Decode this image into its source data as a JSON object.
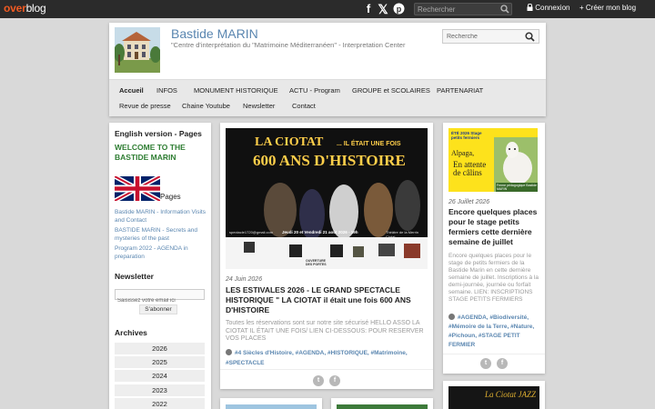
{
  "topbar": {
    "logo_over": "over",
    "logo_blog": "blog",
    "search_placeholder": "Rechercher",
    "login": "Connexion",
    "create_blog": "Créer mon blog",
    "social": [
      "facebook-icon",
      "x-icon",
      "pinterest-icon"
    ]
  },
  "header": {
    "title": "Bastide MARIN",
    "description": "\"Centre d'interprétation du \"Matrimoine Méditerranéen\" - Interpretation Center",
    "search_placeholder": "Recherche"
  },
  "nav": {
    "row1": [
      "Accueil",
      "INFOS",
      "MONUMENT HISTORIQUE",
      "ACTU - Program",
      "GROUPE et SCOLAIRES",
      "PARTENARIAT"
    ],
    "row2": [
      "Revue de presse",
      "Chaine Youtube",
      "Newsletter",
      "Contact"
    ],
    "active": "Accueil"
  },
  "sidebar": {
    "pages_heading": "English version - Pages",
    "welcome": "WELCOME TO THE BASTIDE MARIN",
    "pages_label": "Pages",
    "links": [
      "Bastide MARIN - Information Visits and Contact",
      "BASTIDE MARIN - Secrets and mysteries of the past",
      "Program 2022 - AGENDA in preparation"
    ],
    "newsletter_heading": "Newsletter",
    "email_placeholder": "Saisissez votre email ici",
    "subscribe": "S'abonner",
    "archives_heading": "Archives",
    "years": [
      "2026",
      "2025",
      "2024",
      "2023",
      "2022"
    ]
  },
  "main_article": {
    "poster": {
      "line1": "LA CIOTAT",
      "line1_small": "... IL ÉTAIT UNE FOIS",
      "line2": "600 ANS D'HISTOIRE",
      "email": "spectacle1720@gmail.com",
      "dates": "Jeudi 20 et Vendredi 21 août 2026 - 19h",
      "venue": "Théâtre de la Merrin Ciotat",
      "openings": "OUVERTURE DES PORTES"
    },
    "date": "24 Juin 2026",
    "title": "LES ESTIVALES 2026 - LE GRAND SPECTACLE HISTORIQUE \" LA CIOTAT il était une fois 600 ANS D'HISTOIRE",
    "excerpt": "Toutes les réservations sont sur notre site sécurisé HELLO ASSO LA CIOTAT IL ÉTAIT UNE FOIS/ LIEN CI-DESSOUS: POUR RESERVER VOS PLACES",
    "tags": "#4 Siècles d'Histoire, #AGENDA, #HISTORIQUE, #Matrimoine, #SPECTACLE"
  },
  "right_article": {
    "poster": {
      "title": "ÉTÉ 2026 Stage petits fermiers",
      "name": "Alpaga,",
      "text": "En attente de câlins",
      "footer": "Ferme pédagogique Bastide MARIN"
    },
    "date": "26 Juillet 2026",
    "title": "Encore quelques places pour le stage petits fermiers cette dernière semaine de juillet",
    "excerpt": "Encore quelques places pour le stage de petits fermiers de la Bastide Marin en cette dernière semaine de juillet. Inscriptions à la demi-journée, journée ou forfait semaine. LIEN: INSCRIPTIONS STAGE PETITS FERMIERS",
    "tags": "#AGENDA, #Biodiversité, #Mémoire de la Terre, #Nature, #Pichoun, #STAGE PETIT FERMIER"
  },
  "peek_card": {
    "label": "La Ciotat JAZZ"
  },
  "colors": {
    "accent": "#5a86b0",
    "welcome_green": "#2e7d32",
    "topbar": "#2b2b2b",
    "brand_orange": "#f15a22"
  }
}
